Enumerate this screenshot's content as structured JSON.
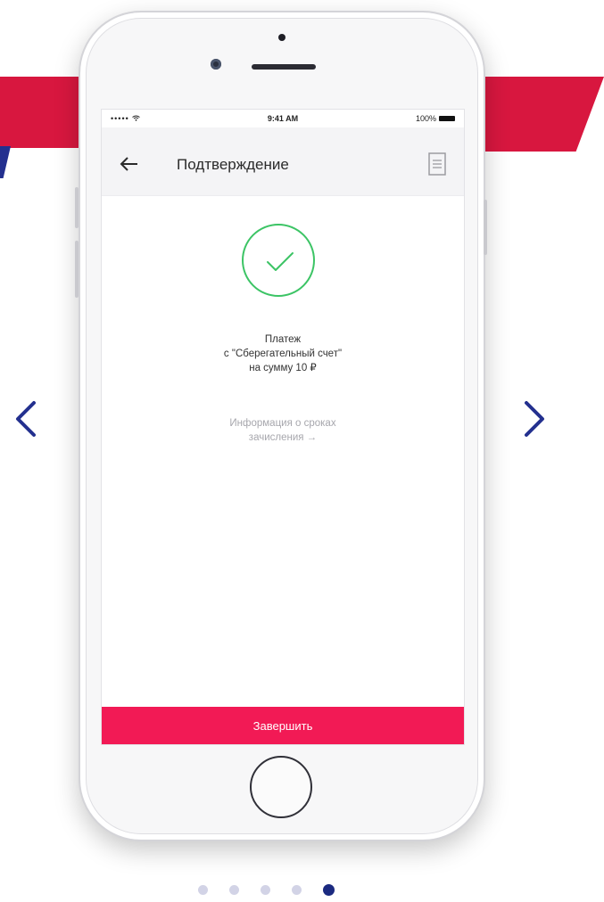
{
  "colors": {
    "brand_red": "#d8173f",
    "accent_pink": "#f21a55",
    "success_green": "#3cc465",
    "nav_blue": "#23308f"
  },
  "status_bar": {
    "signal": "••••• ",
    "time": "9:41 AM",
    "battery": "100%"
  },
  "header": {
    "title": "Подтверждение",
    "back_icon": "arrow-left-icon",
    "receipt_icon": "receipt-icon"
  },
  "payment": {
    "line1": "Платеж",
    "line2": "с \"Сберегательный счет\"",
    "line3": "на сумму 10 ₽"
  },
  "info_link": {
    "line1": "Информация о сроках",
    "line2": "зачисления →"
  },
  "finish_button": {
    "label": "Завершить"
  },
  "carousel": {
    "total_slides": 5,
    "active_slide": 5
  }
}
